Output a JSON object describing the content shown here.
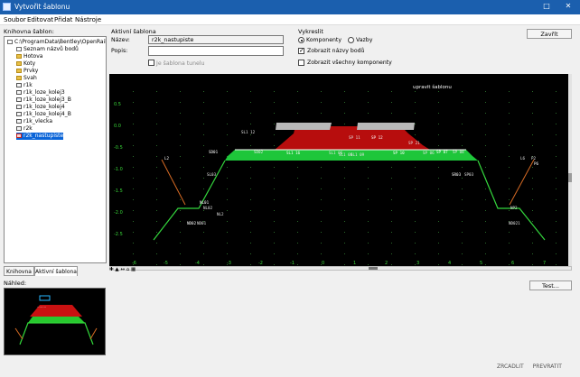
{
  "window": {
    "title": "Vytvořit šablonu"
  },
  "menu": [
    "Soubor",
    "Editovat",
    "Přidat",
    "Nástroje"
  ],
  "library": {
    "label": "Knihovna šablon:",
    "tree": [
      {
        "label": "C:\\ProgramData\\Bentley\\OpenRail Des",
        "icon": "template-library-icon",
        "indent": 0
      },
      {
        "label": "Seznam názvů bodů",
        "icon": "point-name-list-icon",
        "indent": 1
      },
      {
        "label": "Hotova",
        "icon": "folder-icon",
        "indent": 1
      },
      {
        "label": "Koty",
        "icon": "folder-icon",
        "indent": 1
      },
      {
        "label": "Prvky",
        "icon": "folder-icon",
        "indent": 1
      },
      {
        "label": "Svah",
        "icon": "folder-icon",
        "indent": 1
      },
      {
        "label": "r1k",
        "icon": "template-icon",
        "indent": 1
      },
      {
        "label": "r1k_loze_kolej3",
        "icon": "template-icon",
        "indent": 1
      },
      {
        "label": "r1k_loze_kolej3_B",
        "icon": "template-icon",
        "indent": 1
      },
      {
        "label": "r1k_loze_kolej4",
        "icon": "template-icon",
        "indent": 1
      },
      {
        "label": "r1k_loze_kolej4_B",
        "icon": "template-icon",
        "indent": 1
      },
      {
        "label": "r1k_vlecka",
        "icon": "template-icon",
        "indent": 1
      },
      {
        "label": "r2k",
        "icon": "template-icon",
        "indent": 1
      },
      {
        "label": "r2k_nastupiste",
        "icon": "active-template-icon",
        "indent": 1,
        "selected": true
      }
    ],
    "tabs": [
      "Knihovna",
      "Aktivní šablona"
    ]
  },
  "preview": {
    "label": "Náhled:"
  },
  "active": {
    "label": "Aktivní šablona",
    "name_label": "Název:",
    "name_value": "r2k_nastupiste",
    "desc_label": "Popis:",
    "desc_value": "",
    "tunnel_label": "Je šablona tunelu"
  },
  "display": {
    "label": "Vykreslit",
    "components": "Komponenty",
    "links": "Vazby",
    "show_names": "Zobrazit názvy bodů",
    "show_all": "Zobrazit všechny komponenty"
  },
  "buttons": {
    "close": "Zavřít",
    "test": "Test..."
  },
  "viewer": {
    "title": "upravit šablonu",
    "y_ticks": [
      "0.5",
      "0.0",
      "-0.5",
      "-1.0",
      "-1.5",
      "-2.0",
      "-2.5"
    ],
    "x_ticks": [
      "-6",
      "-5",
      "-4",
      "-3",
      "-2",
      "-1",
      "0",
      "1",
      "2",
      "3",
      "4",
      "5",
      "6",
      "7"
    ],
    "points": [
      "SD01",
      "SD02",
      "SL03",
      "SR03",
      "SP03",
      "SL1 12",
      "SL1 16",
      "SL1 06",
      "SP 11",
      "SP 12",
      "SL1 08",
      "SL1 09",
      "SP 10",
      "SP 21",
      "SP 06",
      "SP 07",
      "SP 08",
      "ND01",
      "ND02",
      "ND021",
      "NL02",
      "NL01",
      "NL2",
      "NP2",
      "L2",
      "L6",
      "P2",
      "P6"
    ]
  },
  "status": {
    "mirror": "ZRCADLIT",
    "rotate": "PREVRATIT"
  }
}
